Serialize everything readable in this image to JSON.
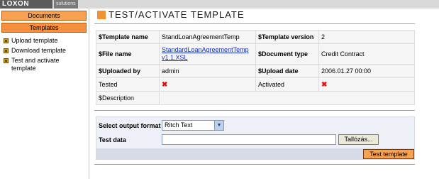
{
  "header": {
    "logo": "LOXON",
    "logo_sub": "solutions"
  },
  "sidebar": {
    "buttons": [
      {
        "label": "Documents"
      },
      {
        "label": "Templates"
      }
    ],
    "items": [
      {
        "label": "Upload template"
      },
      {
        "label": "Download template"
      },
      {
        "label": "Test and activate template"
      }
    ]
  },
  "page": {
    "title": "TEST/ACTIVATE TEMPLATE"
  },
  "info": {
    "template_name_label": "$Template name",
    "template_name_value": "StandLoanAgreementTemp",
    "template_version_label": "$Template version",
    "template_version_value": "2",
    "file_name_label": "$File name",
    "file_name_value": "StandardLoanAgreementTemp v1.1.XSL",
    "document_type_label": "$Document type",
    "document_type_value": "Credit Contract",
    "uploaded_by_label": "$Uploaded by",
    "uploaded_by_value": "admin",
    "upload_date_label": "$Upload date",
    "upload_date_value": "2006.01.27 00:00",
    "tested_label": "Tested",
    "tested_value": "✖",
    "activated_label": "Activated",
    "activated_value": "✖",
    "description_label": "$Description",
    "description_value": ""
  },
  "form": {
    "output_format_label": "Select output format",
    "output_format_value": "Ritch Text",
    "test_data_label": "Test data",
    "test_data_value": "",
    "browse_label": "Tallózás...",
    "test_button_label": "Test template"
  },
  "colors": {
    "accent": "#f29130",
    "button": "#f7a253",
    "error": "#e01010",
    "link": "#1530c8"
  }
}
